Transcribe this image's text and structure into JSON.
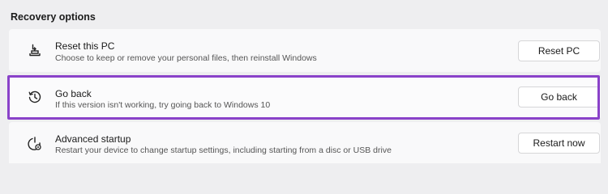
{
  "section": {
    "title": "Recovery options"
  },
  "options": [
    {
      "title": "Reset this PC",
      "description": "Choose to keep or remove your personal files, then reinstall Windows",
      "button": "Reset PC",
      "icon": "reset-pc-icon"
    },
    {
      "title": "Go back",
      "description": "If this version isn't working, try going back to Windows 10",
      "button": "Go back",
      "icon": "history-icon"
    },
    {
      "title": "Advanced startup",
      "description": "Restart your device to change startup settings, including starting from a disc or USB drive",
      "button": "Restart now",
      "icon": "advanced-startup-icon"
    }
  ],
  "colors": {
    "highlight": "#8a42c9",
    "background": "#eeeef0",
    "card": "#f9f9fa"
  }
}
